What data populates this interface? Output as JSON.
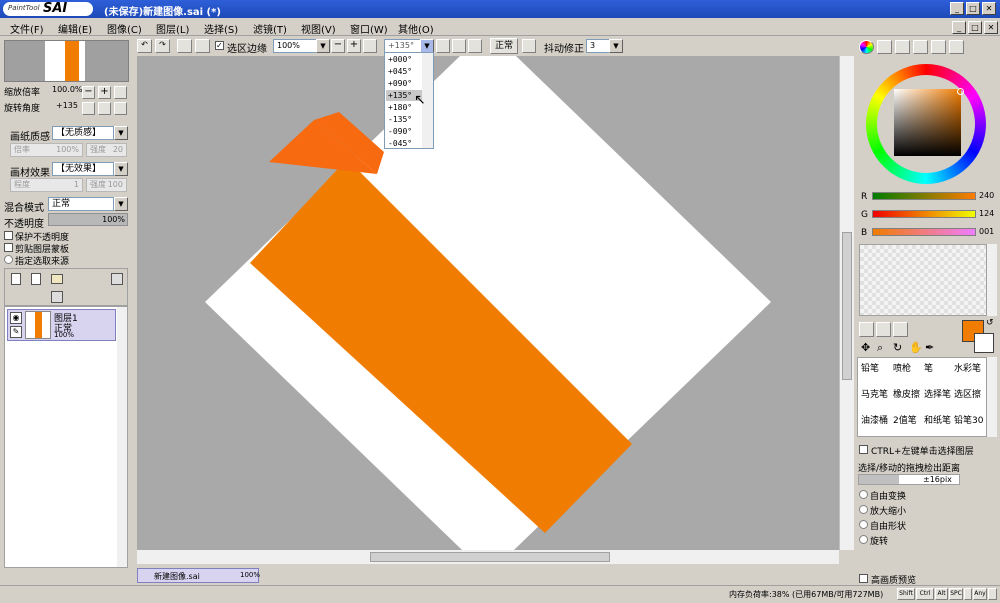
{
  "window": {
    "title": "(未保存)新建图像.sai (*)",
    "logo_text": "PaintTool",
    "logo_brand": "SAI"
  },
  "menu": [
    "文件(F)",
    "编辑(E)",
    "图像(C)",
    "图层(L)",
    "选择(S)",
    "滤镜(T)",
    "视图(V)",
    "窗口(W)",
    "其他(O)"
  ],
  "toolbar": {
    "selection_edge_label": "选区边缘",
    "zoom": "100%",
    "rotation": "+135°",
    "blend": "正常",
    "stabilizer_label": "抖动修正",
    "stabilizer": "3"
  },
  "rotation_options": [
    "+000°",
    "+045°",
    "+090°",
    "+135°",
    "+180°",
    "-135°",
    "-090°",
    "-045°"
  ],
  "rotation_selected_index": 3,
  "navigator": {
    "zoom_label": "缩放倍率",
    "zoom_value": "100.0%",
    "angle_label": "旋转角度",
    "angle_value": "+135"
  },
  "paper": {
    "texture_label": "画纸质感",
    "texture_value": "【无质感】",
    "rate_label": "倍率",
    "rate_value": "100%",
    "strength_label": "强度",
    "strength_value": "20",
    "effect_label": "画材效果",
    "effect_value": "【无效果】",
    "degree_label": "程度",
    "degree_value": "1",
    "strength2_label": "强度",
    "strength2_value": "100"
  },
  "layer_props": {
    "blend_label": "混合模式",
    "blend_value": "正常",
    "opacity_label": "不透明度",
    "opacity_value": "100%",
    "opacity_fraction": 1.0,
    "protect_opacity": "保护不透明度",
    "clip_group": "剪贴图层蒙板",
    "select_source": "指定选取来源"
  },
  "layer": {
    "name": "图层1",
    "blend": "正常",
    "opacity": "100%"
  },
  "doc_tab": {
    "name": "新建图像.sai",
    "zoom": "100%"
  },
  "color": {
    "r": "240",
    "g": "124",
    "b": "001",
    "r_label": "R",
    "g_label": "G",
    "b_label": "B",
    "current": "#f07c01"
  },
  "brushes": [
    [
      "铅笔",
      "喷枪",
      "笔",
      "水彩笔"
    ],
    [
      "马克笔",
      "橡皮擦",
      "选择笔",
      "选区擦"
    ],
    [
      "油漆桶",
      "2值笔",
      "和纸笔",
      "铅笔30"
    ]
  ],
  "options": {
    "ctrl_click": "CTRL+左键单击选择图层",
    "drag_label": "选择/移动的拖拽检出距离",
    "drag_value": "±16pix",
    "modes": [
      "自由变换",
      "放大缩小",
      "自由形状",
      "旋转"
    ],
    "hq_preview": "高画质预览"
  },
  "status": {
    "memory": "内存负荷率:38% (已用67MB/可用727MB)",
    "keys": [
      "Shift",
      "Ctrl",
      "Alt",
      "SPC",
      "Any"
    ]
  }
}
